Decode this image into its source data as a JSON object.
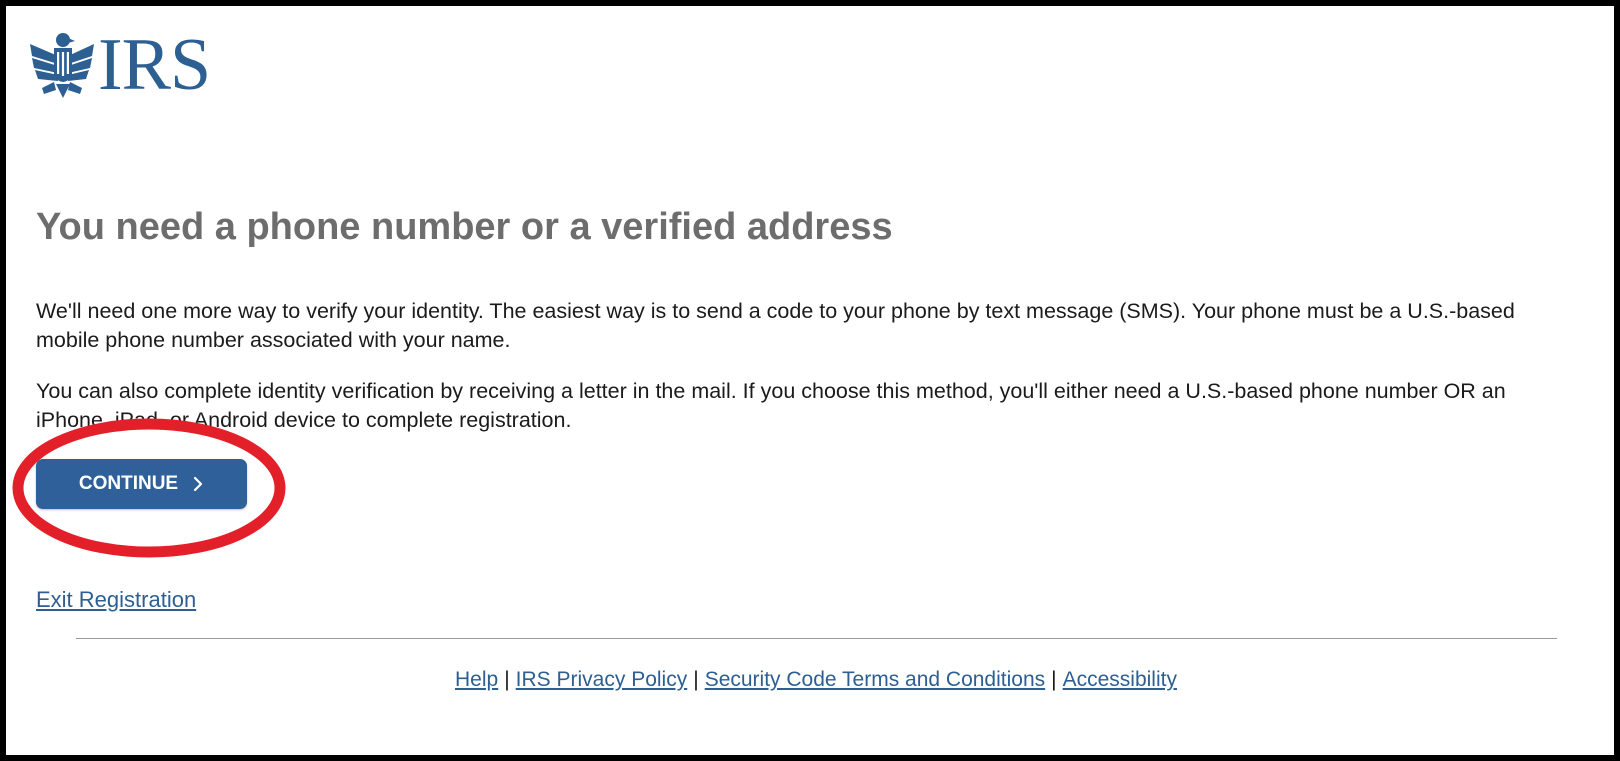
{
  "logo": {
    "wordmark": "IRS",
    "icon": "eagle-emblem-icon",
    "color": "#2d5f92"
  },
  "main": {
    "title": "You need a phone number or a verified address",
    "paragraph1": "We'll need one more way to verify your identity. The easiest way is to send a code to your phone by text message (SMS). Your phone must be a U.S.-based mobile phone number associated with your name.",
    "paragraph2": "You can also complete identity verification by receiving a letter in the mail. If you choose this method, you'll either need a U.S.-based phone number OR an iPhone, iPad, or Android device to complete registration.",
    "continue_label": "CONTINUE",
    "continue_icon": "chevron-right-icon",
    "exit_label": "Exit Registration"
  },
  "footer": {
    "links": [
      "Help",
      "IRS Privacy Policy",
      "Security Code Terms and Conditions",
      "Accessibility"
    ],
    "separator": "|"
  },
  "colors": {
    "brand_blue": "#2d5f92",
    "button_blue": "#2f6099",
    "title_gray": "#6d6d6d",
    "annotation_red": "#e3202a",
    "frame_border": "#000000"
  }
}
